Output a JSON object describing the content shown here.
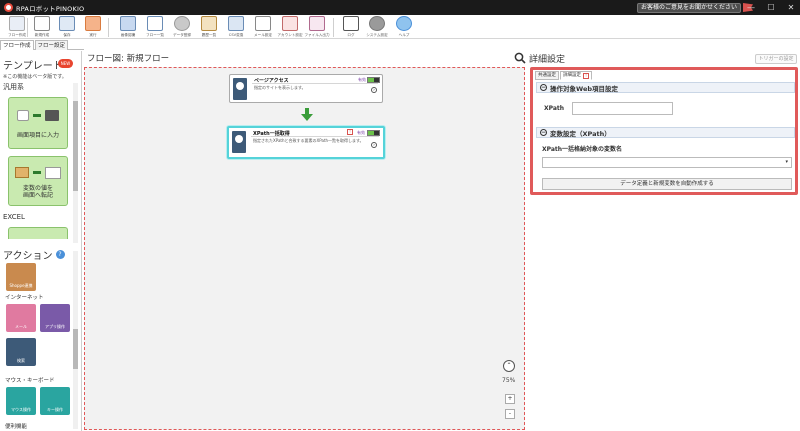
{
  "window": {
    "title": "RPAロボットPINOKIO",
    "notice": "お客様のご意見をお聞かせください",
    "controls": [
      "—",
      "☐",
      "✕"
    ]
  },
  "ribbon": [
    {
      "label": "フロー作成",
      "icon": "flow-create-icon"
    },
    {
      "label": "新規作成",
      "icon": "new-file-icon"
    },
    {
      "label": "保存",
      "icon": "save-icon"
    },
    {
      "label": "実行",
      "icon": "run-icon"
    },
    {
      "label": "画像認識",
      "icon": "image-recognition-icon"
    },
    {
      "label": "フロー一覧",
      "icon": "flow-list-icon"
    },
    {
      "label": "データ登録",
      "icon": "database-icon"
    },
    {
      "label": "履歴一覧",
      "icon": "history-icon"
    },
    {
      "label": "CSV変換",
      "icon": "csv-icon"
    },
    {
      "label": "メール設定",
      "icon": "mail-icon"
    },
    {
      "label": "アカウント設定",
      "icon": "account-icon"
    },
    {
      "label": "ファイル入出力",
      "icon": "file-io-icon"
    },
    {
      "label": "ログ",
      "icon": "log-icon"
    },
    {
      "label": "システム設定",
      "icon": "system-settings-icon"
    },
    {
      "label": "ヘルプ",
      "icon": "help-icon"
    }
  ],
  "left_tabs": [
    "フロー作成",
    "フロー設定"
  ],
  "templates": {
    "title": "テンプレート",
    "badge": "NEW",
    "note": "※この機能はベータ版です。",
    "category_general": "汎用系",
    "cards": [
      {
        "label": "画面項目に入力"
      },
      {
        "label": "変数の値を\n画面へ転記"
      }
    ],
    "category_excel": "EXCEL"
  },
  "actions": {
    "title": "アクション",
    "help": "?",
    "tiles_top": [
      {
        "label": "Shoppe連携"
      }
    ],
    "category_internet": "インターネット",
    "tiles_internet": [
      {
        "label": "メール"
      },
      {
        "label": "アプリ操作"
      },
      {
        "label": "検索"
      }
    ],
    "category_mouse": "マウス・キーボード",
    "tiles_mouse": [
      {
        "label": "マウス操作"
      },
      {
        "label": "キー操作"
      }
    ],
    "category_more": "便利機能"
  },
  "flow": {
    "title": "フロー図: 新規フロー",
    "zoom_up": "⌃",
    "zoom_level": "75%",
    "zoom_in": "+",
    "zoom_out": "-",
    "nodes": [
      {
        "name": "ページアクセス",
        "desc": "指定のサイトを表示します。",
        "valid": "有効"
      },
      {
        "name": "XPath一括取得",
        "desc": "指定されたXPathと合致する要素のXPath一覧を取得します。",
        "valid": "有効",
        "warn": "!"
      }
    ]
  },
  "detail": {
    "title": "詳細設定",
    "trigger": "トリガーの設定",
    "tabs": [
      {
        "label": "共通設定"
      },
      {
        "label": "詳細設定",
        "warn": "!"
      }
    ],
    "sec1": "操作対象Web項目設定",
    "xpath_label": "XPath",
    "xpath_value": "",
    "sec2": "変数設定（XPath）",
    "var_label": "XPath一括格納対象の変数名",
    "var_value": "",
    "auto_button": "データ定義と新規変数を自動作成する"
  }
}
